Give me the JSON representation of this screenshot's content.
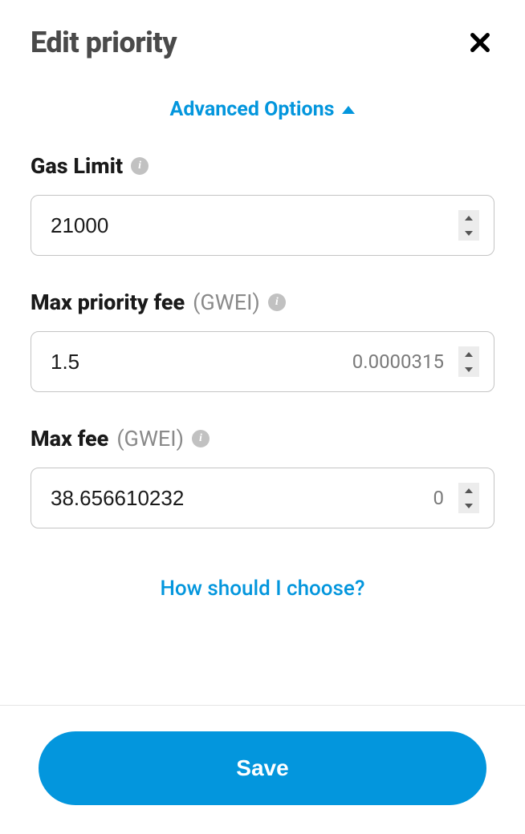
{
  "header": {
    "title": "Edit priority"
  },
  "advanced": {
    "label": "Advanced Options"
  },
  "fields": {
    "gasLimit": {
      "label": "Gas Limit",
      "value": "21000"
    },
    "maxPriorityFee": {
      "label": "Max priority fee",
      "unit": "(GWEI)",
      "value": "1.5",
      "secondary": "0.0000315"
    },
    "maxFee": {
      "label": "Max fee",
      "unit": "(GWEI)",
      "value": "38.656610232",
      "secondary": "0"
    }
  },
  "helpLink": "How should I choose?",
  "footer": {
    "saveLabel": "Save"
  },
  "colors": {
    "accent": "#0396dd"
  }
}
